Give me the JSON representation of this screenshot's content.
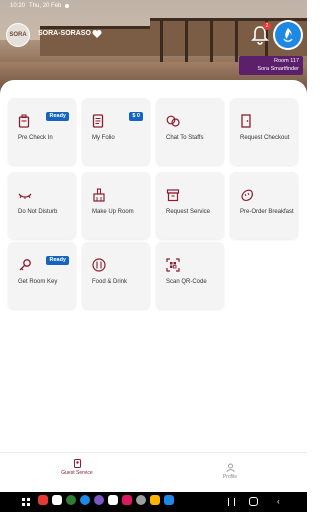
{
  "status": {
    "time": "10:20",
    "date": "Thu, 20 Feb"
  },
  "header": {
    "hotel_name": "SORA-SORASO",
    "notification_count": "2",
    "room_line1": "Room 117",
    "room_line2": "Sora Smartfinder"
  },
  "tiles": [
    {
      "label": "Pre Check In",
      "badge": "Ready",
      "icon": "suitcase-icon"
    },
    {
      "label": "My Folio",
      "badge": "$ 0",
      "icon": "receipt-icon"
    },
    {
      "label": "Chat To Staffs",
      "badge": "",
      "icon": "chat-icon"
    },
    {
      "label": "Request Checkout",
      "badge": "",
      "icon": "door-exit-icon"
    },
    {
      "label": "Do Not Disturb",
      "badge": "",
      "icon": "closed-eye-icon"
    },
    {
      "label": "Make Up Room",
      "badge": "",
      "icon": "broom-icon"
    },
    {
      "label": "Request Service",
      "badge": "",
      "icon": "box-icon"
    },
    {
      "label": "Pre-Order Breakfast",
      "badge": "",
      "icon": "bread-icon"
    },
    {
      "label": "Get Room Key",
      "badge": "Ready",
      "icon": "key-icon"
    },
    {
      "label": "Food & Drink",
      "badge": "",
      "icon": "utensils-icon"
    },
    {
      "label": "Scan QR-Code",
      "badge": "",
      "icon": "qr-scan-icon"
    }
  ],
  "bottom_nav": {
    "guest_service": "Guest Service",
    "profile": "Profile"
  },
  "colors": {
    "accent": "#8b1e2e",
    "badge": "#1565c0",
    "room_tag": "#5b1f6b"
  }
}
